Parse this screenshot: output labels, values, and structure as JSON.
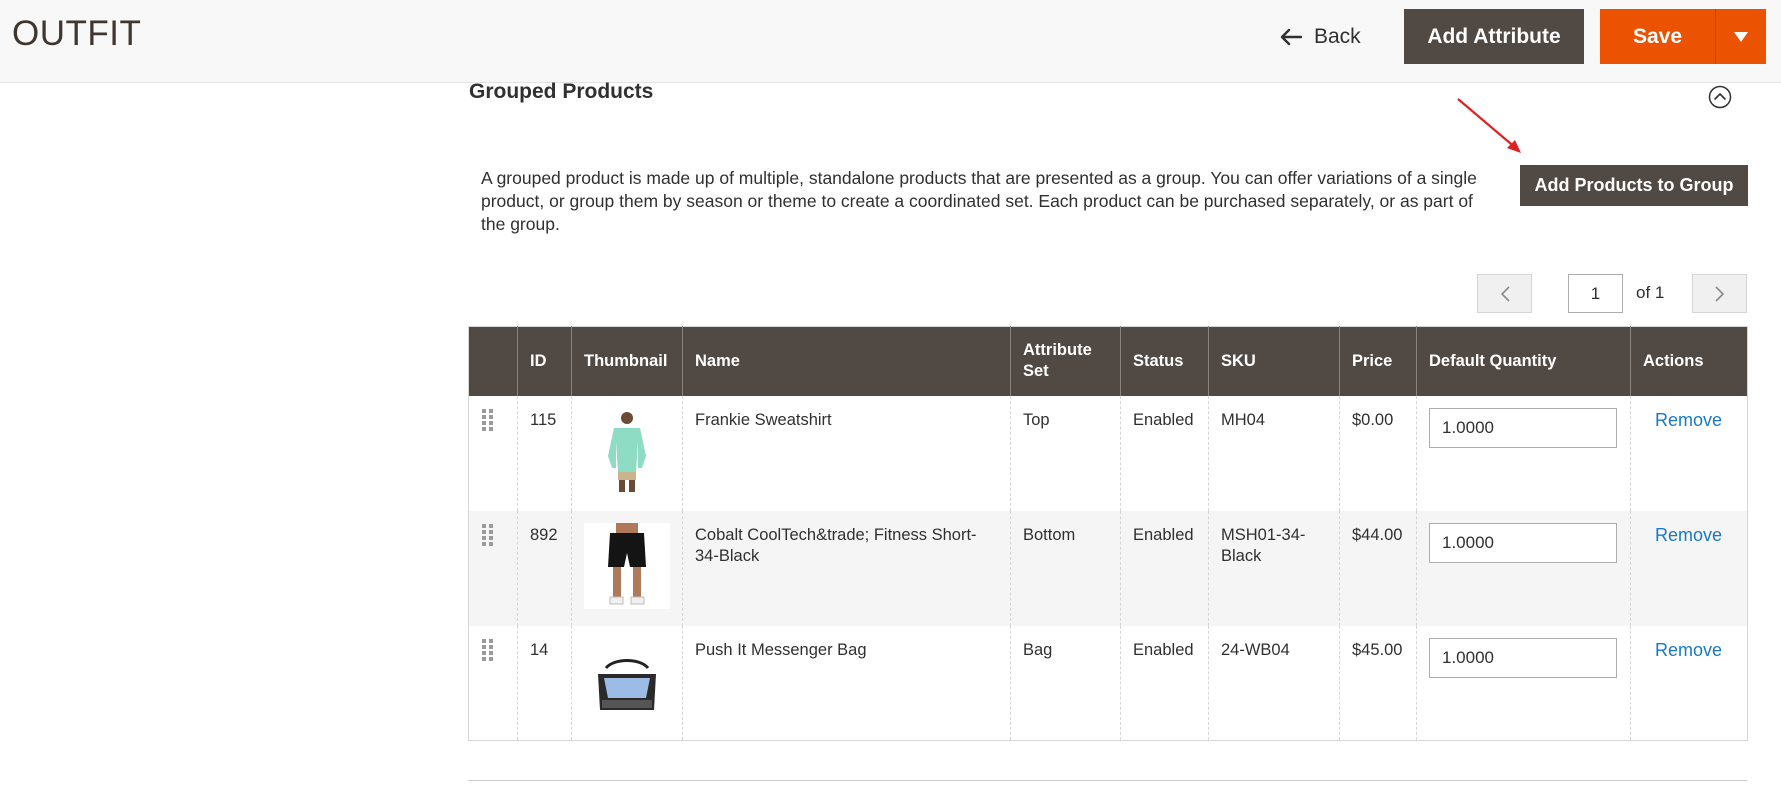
{
  "header": {
    "title": "OUTFIT",
    "back_label": "Back",
    "add_attribute_label": "Add Attribute",
    "save_label": "Save"
  },
  "section": {
    "title": "Grouped Products",
    "description": "A grouped product is made up of multiple, standalone products that are presented as a group. You can offer variations of a single product, or group them by season or theme to create a coordinated set. Each product can be purchased separately, or as part of the group.",
    "add_button_label": "Add Products to Group"
  },
  "pager": {
    "current": "1",
    "total_label": "of 1"
  },
  "table": {
    "columns": [
      "",
      "ID",
      "Thumbnail",
      "Name",
      "Attribute Set",
      "Status",
      "SKU",
      "Price",
      "Default Quantity",
      "Actions"
    ],
    "rows": [
      {
        "id": "115",
        "thumb": "sweatshirt-thumbnail",
        "name": "Frankie Sweatshirt",
        "attribute_set": "Top",
        "status": "Enabled",
        "sku": "MH04",
        "price": "$0.00",
        "qty": "1.0000",
        "action": "Remove"
      },
      {
        "id": "892",
        "thumb": "shorts-thumbnail",
        "name": "Cobalt CoolTech&trade; Fitness Short-34-Black",
        "attribute_set": "Bottom",
        "status": "Enabled",
        "sku": "MSH01-34-Black",
        "price": "$44.00",
        "qty": "1.0000",
        "action": "Remove"
      },
      {
        "id": "14",
        "thumb": "messenger-bag-thumbnail",
        "name": "Push It Messenger Bag",
        "attribute_set": "Bag",
        "status": "Enabled",
        "sku": "24-WB04",
        "price": "$45.00",
        "qty": "1.0000",
        "action": "Remove"
      }
    ]
  },
  "colors": {
    "header_bg": "#514943",
    "primary_orange": "#eb5202",
    "link_blue": "#1979c3",
    "annotation_red": "#e02020"
  },
  "icons": {
    "back": "arrow-left-icon",
    "save_toggle": "caret-down-icon",
    "collapse": "chevron-up-circle-icon",
    "drag": "drag-handle-icon",
    "pager_prev": "chevron-left-icon",
    "pager_next": "chevron-right-icon"
  }
}
